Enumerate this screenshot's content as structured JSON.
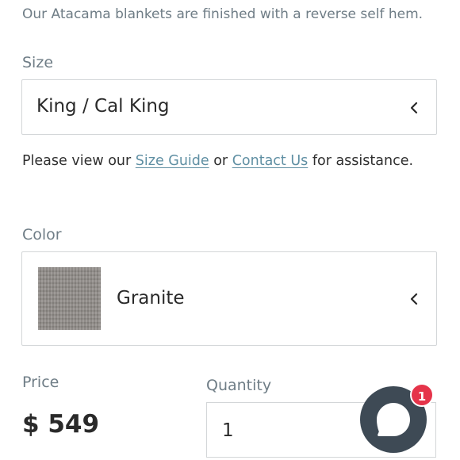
{
  "intro_text": "Our Atacama blankets are finished with a reverse self hem.",
  "size": {
    "label": "Size",
    "selected": "King / Cal King"
  },
  "help": {
    "prefix": "Please view our ",
    "size_guide_link": "Size Guide",
    "middle": " or ",
    "contact_link": "Contact Us",
    "suffix": " for assistance."
  },
  "color": {
    "label": "Color",
    "selected": "Granite",
    "swatch_icon": "granite-fabric-swatch"
  },
  "price": {
    "label": "Price",
    "value": "$ 549"
  },
  "quantity": {
    "label": "Quantity",
    "value": "1"
  },
  "chat": {
    "icon": "chat-bubble-icon",
    "badge_count": "1",
    "button_color": "#3e4a55",
    "badge_color": "#e5344a"
  },
  "colors": {
    "label_text": "#6f7d86",
    "link": "#5f8fa3",
    "border": "#d3d6d8"
  }
}
